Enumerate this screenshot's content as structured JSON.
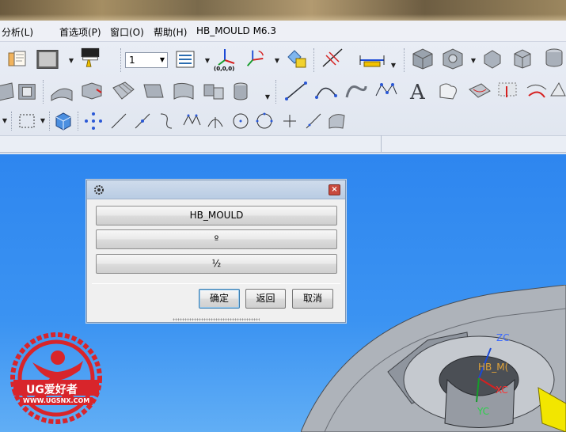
{
  "menubar": {
    "items": [
      "分析(L)",
      "首选项(P)",
      "窗口(O)",
      "帮助(H)",
      "HB_MOULD M6.3"
    ]
  },
  "toolbar": {
    "layer_select_value": "1",
    "coord_label": "(0,0,0)"
  },
  "dialog": {
    "buttons": [
      "HB_MOULD",
      "º",
      "½"
    ],
    "ok_label": "确定",
    "back_label": "返回",
    "cancel_label": "取消"
  },
  "viewport": {
    "axis_labels": {
      "zc": "ZC",
      "xc": "XC",
      "yc": "YC",
      "workpiece": "HB_M("
    }
  },
  "logo": {
    "brand": "UG爱好者",
    "url": "WWW.UGSNX.COM"
  },
  "colors": {
    "viewport_top": "#2e86ef",
    "viewport_bottom": "#61aef5",
    "dialog_bg": "#f0f0f0",
    "logo_red": "#d8252b",
    "model_gray": "#a9aeb6",
    "accent_yellow": "#f2e600"
  },
  "icons": [
    "sheet-icon",
    "color-box-icon",
    "paint-brush-icon",
    "layer-list-icon",
    "wcs-origin-icon",
    "wcs-rotate-icon",
    "wcs-display-icon",
    "measure-distance-icon",
    "ruler-icon",
    "solid-cube-icon",
    "curve-icon",
    "line-icon",
    "arc-icon",
    "text-icon",
    "point-icon"
  ]
}
